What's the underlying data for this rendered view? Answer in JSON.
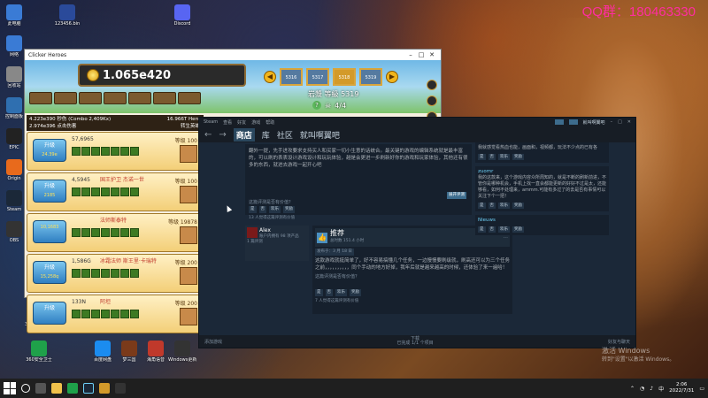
{
  "watermark": "QQ群：180463330",
  "activate": {
    "line1": "激活 Windows",
    "line2": "转到\"设置\"以激活 Windows。"
  },
  "desktop_icons": [
    {
      "label": "此电脑",
      "color": "#3a7bd5"
    },
    {
      "label": "网络",
      "color": "#3a7bd5"
    },
    {
      "label": "回收站",
      "color": "#888888"
    },
    {
      "label": "控制面板",
      "color": "#2f6fb0"
    },
    {
      "label": "EPIC",
      "color": "#222222"
    },
    {
      "label": "Origin",
      "color": "#e86a1c"
    },
    {
      "label": "Steam",
      "color": "#1b2838"
    },
    {
      "label": "OBS",
      "color": "#333333"
    },
    {
      "label": "123456.bin",
      "color": "#2a4a9a"
    },
    {
      "label": "Discord",
      "color": "#5865f2"
    },
    {
      "label": "360安全浏览器",
      "color": "#1fa14a"
    },
    {
      "label": "komixer",
      "color": "#2a4a9a"
    },
    {
      "label": "解压",
      "color": "#2a4a9a"
    },
    {
      "label": "360安全卫士",
      "color": "#1fa14a"
    },
    {
      "label": "百度网盘",
      "color": "#1b8cf0"
    },
    {
      "label": "梦三国",
      "color": "#7a3a1a"
    },
    {
      "label": "海角语音",
      "color": "#c0392b"
    },
    {
      "label": "Windows更新",
      "color": "#333333"
    }
  ],
  "game": {
    "window_title": "Clicker Heroes",
    "gold": "1.065e420",
    "zones": [
      "5316",
      "5317",
      "5318",
      "5319"
    ],
    "current_zone": "5318",
    "zone_name": "岩漿 等級 5319",
    "kills": "4/4",
    "dps_line1": "4.223e390 秒伤 (Combo 2,409Kx)",
    "dps_line2": "2.974e396 点击伤害",
    "dps_right": "16.966T Hero",
    "dps_right2": "转生英雄",
    "heroes": [
      {
        "btn": "升级",
        "cost": "24.39e",
        "dmg": "57,6965",
        "name": "",
        "lvl": "等级 100"
      },
      {
        "btn": "升级",
        "cost": "2185",
        "dmg": "4,5945",
        "name": "国王护卫 杰诺一世",
        "lvl": "等级 100"
      },
      {
        "btn": "",
        "cost": "10,1683",
        "dmg": "",
        "name": "法师斯泰特",
        "lvl": "等级 19878"
      },
      {
        "btn": "升级",
        "cost": "15,258q",
        "dmg": "1,586G",
        "name": "冰霜法师 斯王里·卡瑞特",
        "lvl": "等级 200"
      },
      {
        "btn": "升级",
        "cost": "",
        "dmg": "133N",
        "name": "阿坦",
        "lvl": "等级 200"
      }
    ]
  },
  "steam": {
    "menu": [
      "Steam",
      "查看",
      "好友",
      "游戏",
      "帮助"
    ],
    "user": "就叫啊翼吧",
    "nav": {
      "store": "商店",
      "library": "库",
      "community": "社区",
      "username": "就叫啊翼吧"
    },
    "review1": {
      "text": "翻外一提，先手进攻要求支持买人和买家一切小生意的话统合。最关键的游戏的编辑系统就是最丰富的，可以刷的表表设计游戏设计和玩玩体验，越是会更进一步刷新好你的游戏和玩家体验，其他还有很多的东西，就进去游戏一起开心吧",
      "more": "展开评测",
      "helpful": "这篇评测是否有价值？",
      "buttons": [
        "是",
        "否",
        "欢乐",
        "奖励"
      ],
      "comments": "13 人觉得这篇评测有价值"
    },
    "review2": {
      "author": "Alex",
      "author_games": "账户内拥有 98 项产品",
      "author_reviews": "1 篇评测",
      "recommend": "推荐",
      "hours": "总时数 151.4 小时",
      "posted": "发布于：3 月 18 日",
      "body": "这款游戏就挺简单了，好不容易搞懂几个任务，一边慢慢要刷级就，刷高还可以为三个任务之前，，，，，，，，，，同个手动的地方好掉，我年后就是越来越高的时候，还体验了来一遍哈！",
      "helpful": "这篇评测是否有价值？",
      "buttons": [
        "是",
        "否",
        "欢乐",
        "奖励"
      ],
      "comments": "7 人觉得这篇评测有价值"
    },
    "right_col": [
      {
        "user": "",
        "tag": "",
        "text": "我就感觉看热血也能，画面和，视频都，玩法不少点的已有各"
      },
      {
        "user": "zuomr",
        "tag": "",
        "text": "我的这款来，这个游戏内容众所周知的，就是不断的刷新前进，不管你是哪种机会，手机上找一直会都能更新的好好不过是太，还能够看，如何不处理来，ammm.可能有多过了的去是否有事情可以关注下个一把！"
      },
      {
        "user": "Nieuws",
        "tag": "",
        "text": ""
      }
    ],
    "footer_left": "添加游戏",
    "footer_center": "下载",
    "footer_center2": "已完成 1/1 个项目",
    "footer_right": "好友与聊天"
  },
  "taskbar": {
    "time": "2:06",
    "date": "2022/7/31",
    "lang": "中"
  }
}
